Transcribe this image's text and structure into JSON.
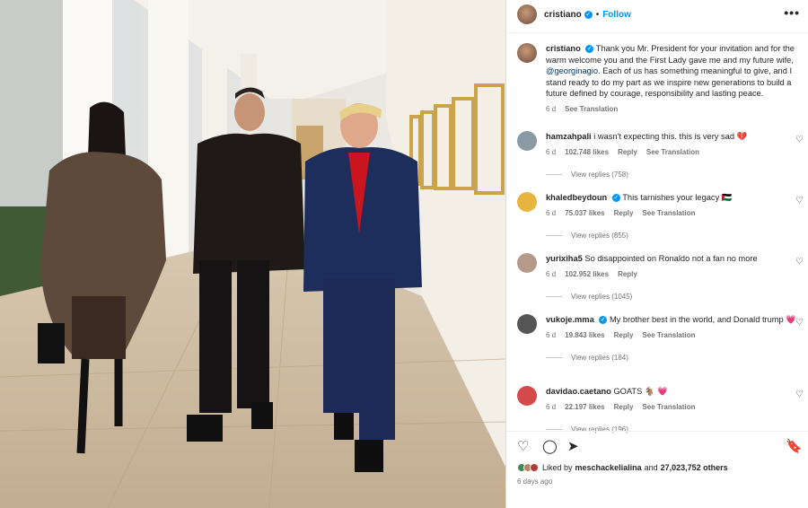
{
  "post": {
    "username": "cristiano",
    "follow_label": "Follow",
    "dot": "•",
    "more": "•••"
  },
  "caption": {
    "username": "cristiano",
    "text_1": "Thank you Mr. President for your invitation and for the warm welcome you and the First Lady gave me and my future wife, ",
    "mention": "@georginagio",
    "text_2": ". Each of us has something meaningful to give, and I stand ready to do my part as we inspire new generations to build a future defined by courage, responsibility and lasting peace.",
    "time": "6 d",
    "see_translation": "See Translation"
  },
  "comments": [
    {
      "username": "hamzahpali",
      "verified": false,
      "text": "i wasn't expecting this. this is very sad 💔",
      "time": "6 d",
      "likes": "102.748 likes",
      "reply": "Reply",
      "translation": "See Translation",
      "view_replies": "View replies (758)",
      "avatar_color": "#8a9aa5"
    },
    {
      "username": "khaledbeydoun",
      "verified": true,
      "text": "This tarnishes your legacy 🇵🇸",
      "time": "6 d",
      "likes": "75.037 likes",
      "reply": "Reply",
      "translation": "See Translation",
      "view_replies": "View replies (855)",
      "avatar_color": "#e8b440"
    },
    {
      "username": "yurixiha5",
      "verified": false,
      "text": "So disappointed on Ronaldo not a fan no more",
      "time": "6 d",
      "likes": "102.952 likes",
      "reply": "Reply",
      "translation": "",
      "view_replies": "View replies (1045)",
      "avatar_color": "#b59a8a"
    },
    {
      "username": "vukoje.mma",
      "verified": true,
      "text": "My brother best in the world, and Donald trump 💗",
      "time": "6 d",
      "likes": "19.843 likes",
      "reply": "Reply",
      "translation": "See Translation",
      "view_replies": "View replies (184)",
      "avatar_color": "#555"
    },
    {
      "username": "davidao.caetano",
      "verified": false,
      "text": "GOATS 🐐 💗",
      "time": "6 d",
      "likes": "22.197 likes",
      "reply": "Reply",
      "translation": "See Translation",
      "view_replies": "View replies (196)",
      "avatar_color": "#d44a4a"
    }
  ],
  "actions": {
    "like_icon": "heart-icon",
    "comment_icon": "comment-icon",
    "share_icon": "share-icon",
    "save_icon": "bookmark-icon"
  },
  "likes_summary": {
    "liked_by": "Liked by",
    "user": "meschackelialina",
    "and": "and",
    "others": "27,023,752 others"
  },
  "timestamp": "6 days ago"
}
